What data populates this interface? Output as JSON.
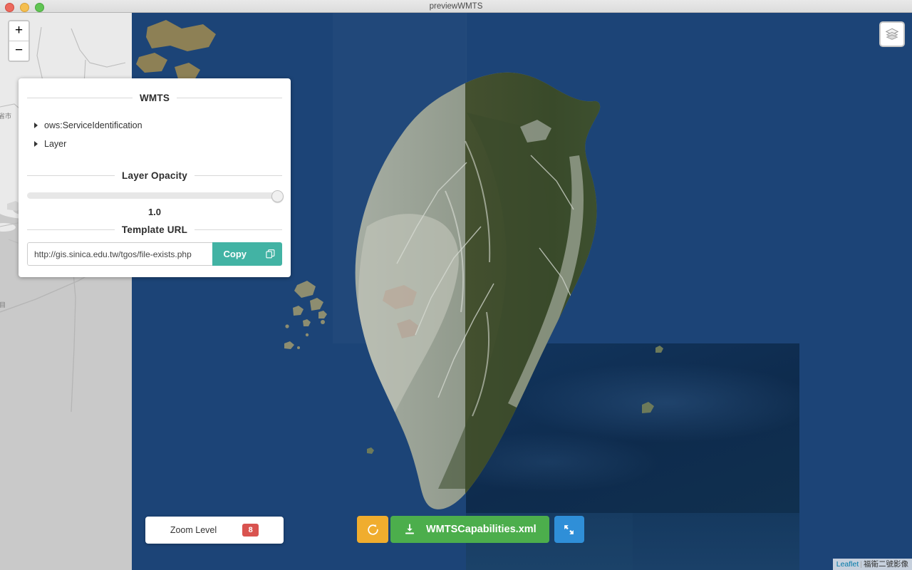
{
  "window": {
    "title": "previewWMTS",
    "traffic_lights": [
      "close",
      "minimize",
      "maximize"
    ]
  },
  "map": {
    "zoom_in_label": "+",
    "zoom_out_label": "−",
    "layers_icon": "layers-stack-icon",
    "basemap_labels": [
      "省市",
      "目"
    ],
    "attribution": {
      "leaflet_label": "Leaflet",
      "separator": "|",
      "source_label": "福衛二號影像"
    }
  },
  "panel": {
    "section_wmts": "WMTS",
    "tree": [
      {
        "label": "ows:ServiceIdentification",
        "caret": "caret-right-icon"
      },
      {
        "label": "Layer",
        "caret": "caret-right-icon"
      }
    ],
    "section_opacity": "Layer Opacity",
    "opacity_value": "1.0",
    "opacity_percent": 100,
    "section_template_url": "Template URL",
    "url_value": "http://gis.sinica.edu.tw/tgos/file-exists.php",
    "url_placeholder": "Template URL",
    "copy_label": "Copy",
    "copy_icon": "copy-pages-icon"
  },
  "bottom": {
    "zoom_level_label": "Zoom Level",
    "zoom_level_value": "8",
    "refresh_icon": "refresh-ccw-icon",
    "download_icon": "download-icon",
    "download_label": "WMTSCapabilities.xml",
    "expand_icon": "expand-arrows-icon"
  },
  "colors": {
    "ocean": "#1c4477",
    "teal": "#42b3a4",
    "green": "#4cae4c",
    "amber": "#f0ad2e",
    "blue": "#2f8fd8",
    "red_badge": "#d9534f"
  }
}
